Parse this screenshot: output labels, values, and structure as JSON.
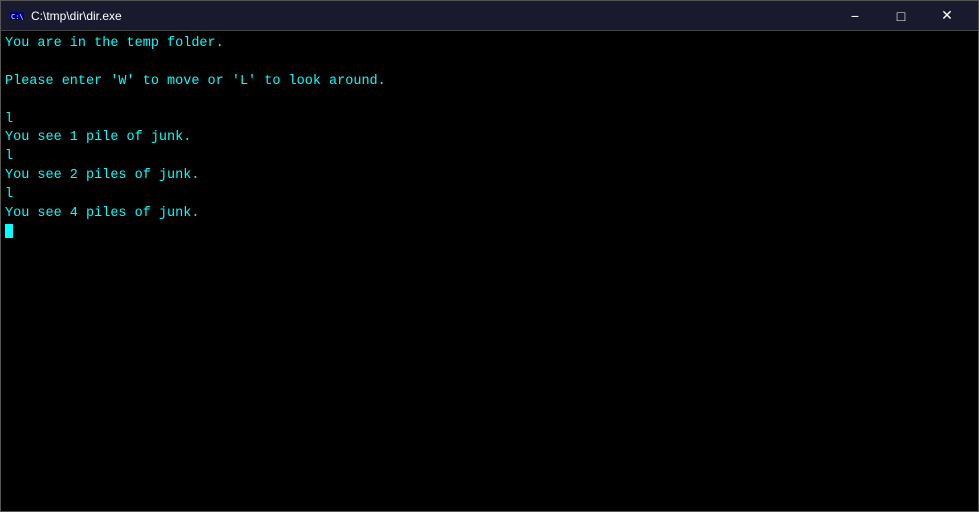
{
  "titlebar": {
    "icon_label": "cmd-icon",
    "title": "C:\\tmp\\dir\\dir.exe",
    "minimize_label": "−",
    "maximize_label": "□",
    "close_label": "✕"
  },
  "console": {
    "lines": [
      "You are in the temp folder.",
      "",
      "Please enter 'W' to move or 'L' to look around.",
      "",
      "l",
      "You see 1 pile of junk.",
      "l",
      "You see 2 piles of junk.",
      "l",
      "You see 4 piles of junk."
    ],
    "cursor_line": ""
  }
}
